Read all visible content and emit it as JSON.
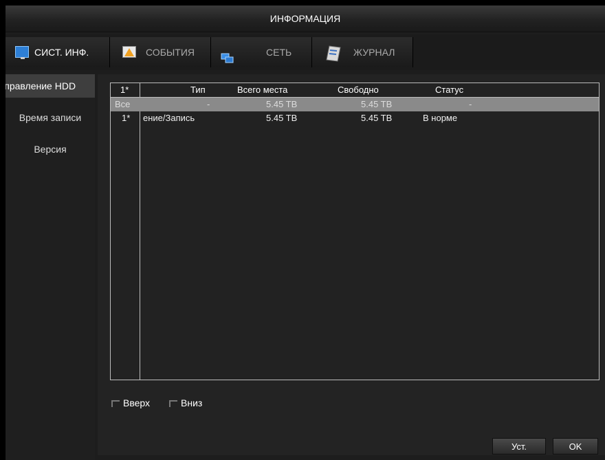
{
  "window": {
    "title": "ИНФОРМАЦИЯ"
  },
  "tabs": [
    {
      "label": "СИСТ. ИНФ.",
      "icon": "monitor-icon",
      "active": true
    },
    {
      "label": "СОБЫТИЯ",
      "icon": "warning-icon",
      "active": false
    },
    {
      "label": "СЕТЬ",
      "icon": "network-icon",
      "active": false
    },
    {
      "label": "ЖУРНАЛ",
      "icon": "log-book-icon",
      "active": false
    }
  ],
  "sidebar": {
    "items": [
      {
        "label": "Управление HDD",
        "active": true
      },
      {
        "label": "Время записи",
        "active": false
      },
      {
        "label": "Версия",
        "active": false
      }
    ]
  },
  "table": {
    "columns": [
      "1*",
      "Тип",
      "Всего места",
      "Свободно",
      "Статус"
    ],
    "rows": [
      {
        "id": "Все",
        "type": "-",
        "total": "5.45 TB",
        "free": "5.45 TB",
        "status": "-",
        "selected": true
      },
      {
        "id": "1*",
        "type": "ение/Запись",
        "total": "5.45 TB",
        "free": "5.45 TB",
        "status": "В норме",
        "selected": false
      }
    ]
  },
  "pager": {
    "up_label": "Вверх",
    "down_label": "Вниз"
  },
  "buttons": {
    "set_label": "Уст.",
    "ok_label": "OK"
  },
  "colors": {
    "selected_row": "#8a8a8a",
    "panel": "#232323",
    "border": "#bdbdbd"
  }
}
